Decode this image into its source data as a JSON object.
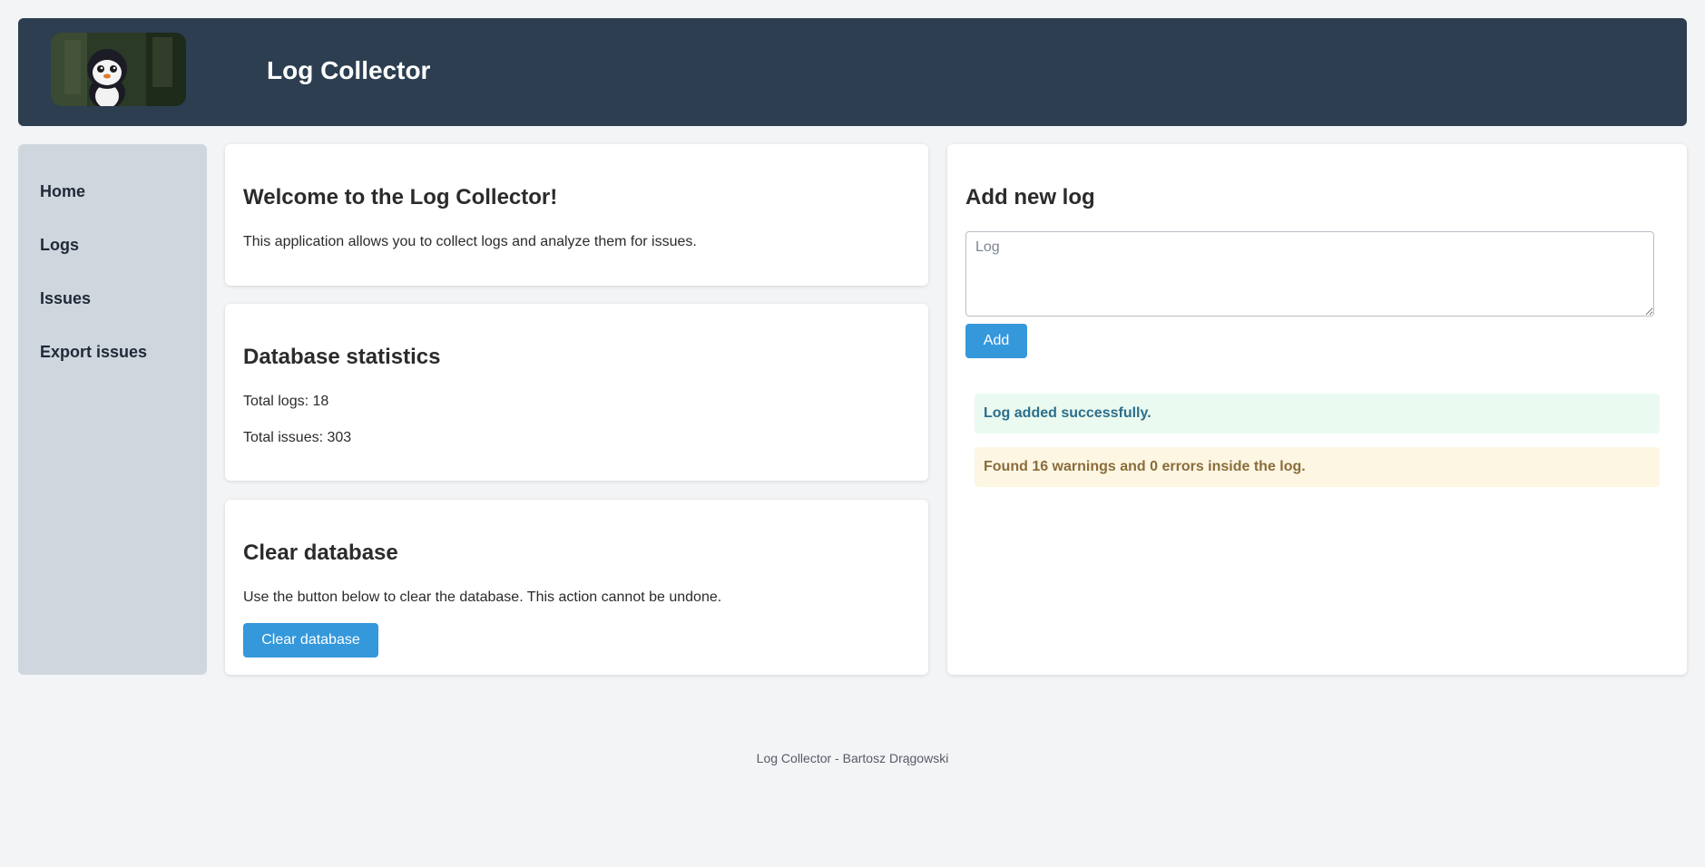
{
  "header": {
    "title": "Log Collector"
  },
  "sidebar": {
    "items": [
      {
        "label": "Home"
      },
      {
        "label": "Logs"
      },
      {
        "label": "Issues"
      },
      {
        "label": "Export issues"
      }
    ]
  },
  "welcome": {
    "heading": "Welcome to the Log Collector!",
    "text": "This application allows you to collect logs and analyze them for issues."
  },
  "stats": {
    "heading": "Database statistics",
    "total_logs": "Total logs: 18",
    "total_issues": "Total issues: 303"
  },
  "clear": {
    "heading": "Clear database",
    "text": "Use the button below to clear the database. This action cannot be undone.",
    "button_label": "Clear database"
  },
  "add_log": {
    "heading": "Add new log",
    "placeholder": "Log",
    "value": "",
    "button_label": "Add",
    "success_message": "Log added successfully.",
    "warning_message": "Found 16 warnings and 0 errors inside the log."
  },
  "colors": {
    "header_bg": "#2c3e50",
    "sidebar_bg": "#d0d6de",
    "accent": "#3498db",
    "success_bg": "#eafaf0",
    "warning_bg": "#fdf6e3"
  },
  "footer": {
    "text": "Log Collector - Bartosz Drągowski"
  }
}
